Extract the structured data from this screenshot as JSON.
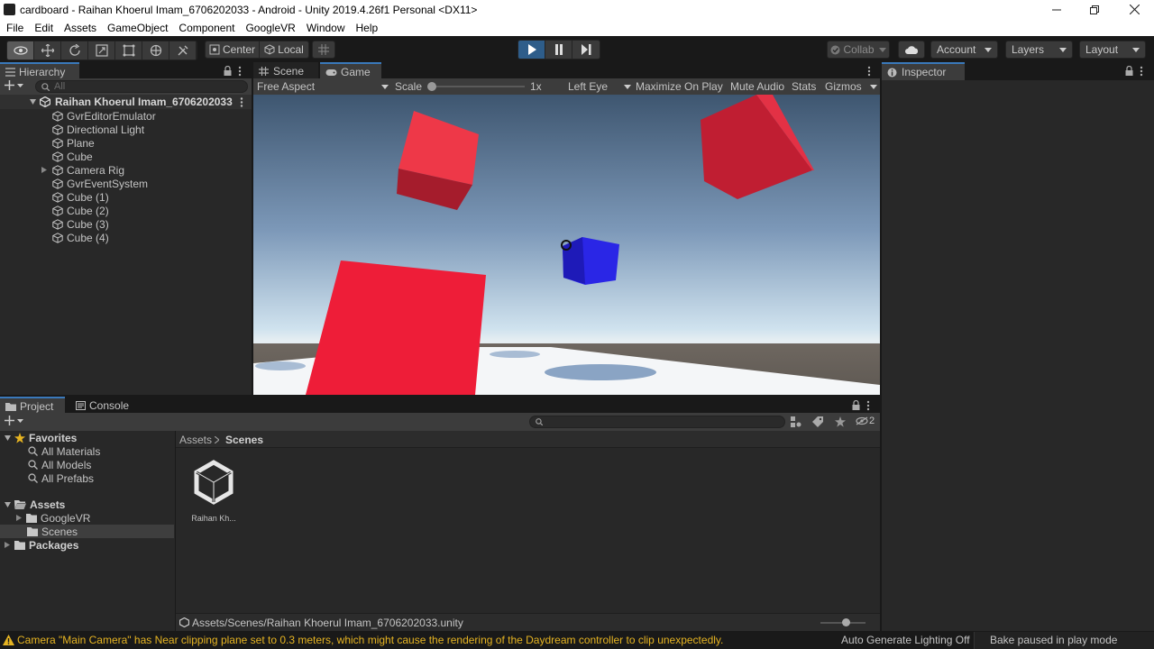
{
  "window": {
    "title": "cardboard - Raihan Khoerul Imam_6706202033 - Android - Unity 2019.4.26f1 Personal <DX11>"
  },
  "menu": [
    "File",
    "Edit",
    "Assets",
    "GameObject",
    "Component",
    "GoogleVR",
    "Window",
    "Help"
  ],
  "toolbar": {
    "pivot_label": "Center",
    "space_label": "Local",
    "collab_label": "Collab",
    "account_label": "Account",
    "layers_label": "Layers",
    "layout_label": "Layout"
  },
  "hierarchy": {
    "tab_label": "Hierarchy",
    "search_placeholder": "All",
    "scene_name": "Raihan Khoerul Imam_6706202033",
    "items": [
      "GvrEditorEmulator",
      "Directional Light",
      "Plane",
      "Cube",
      "Camera Rig",
      "GvrEventSystem",
      "Cube (1)",
      "Cube (2)",
      "Cube (3)",
      "Cube (4)"
    ]
  },
  "game": {
    "scene_tab": "Scene",
    "game_tab": "Game",
    "aspect": "Free Aspect",
    "scale_label": "Scale",
    "scale_value": "1x",
    "eye": "Left Eye",
    "maximize": "Maximize On Play",
    "mute": "Mute Audio",
    "stats": "Stats",
    "gizmos": "Gizmos"
  },
  "inspector": {
    "tab_label": "Inspector"
  },
  "project": {
    "project_tab": "Project",
    "console_tab": "Console",
    "favorites_label": "Favorites",
    "favorites": [
      "All Materials",
      "All Models",
      "All Prefabs"
    ],
    "assets_label": "Assets",
    "asset_folders": [
      "GoogleVR",
      "Scenes"
    ],
    "packages_label": "Packages",
    "breadcrumb": [
      "Assets",
      "Scenes"
    ],
    "file_label": "Raihan Kh...",
    "path": "Assets/Scenes/Raihan Khoerul Imam_6706202033.unity",
    "hidden_count": "2"
  },
  "status": {
    "warning": "Camera \"Main Camera\" has Near clipping plane set to 0.3 meters, which might cause the rendering of the Daydream controller to clip unexpectedly.",
    "lighting": "Auto Generate Lighting Off",
    "bake": "Bake paused in play mode"
  },
  "colors": {
    "accent": "#3a79bb",
    "play_active": "#2e5d8a",
    "panel": "#282828",
    "cube_red": "#e8283c",
    "cube_blue": "#2424e0",
    "warning": "#e6b422"
  }
}
